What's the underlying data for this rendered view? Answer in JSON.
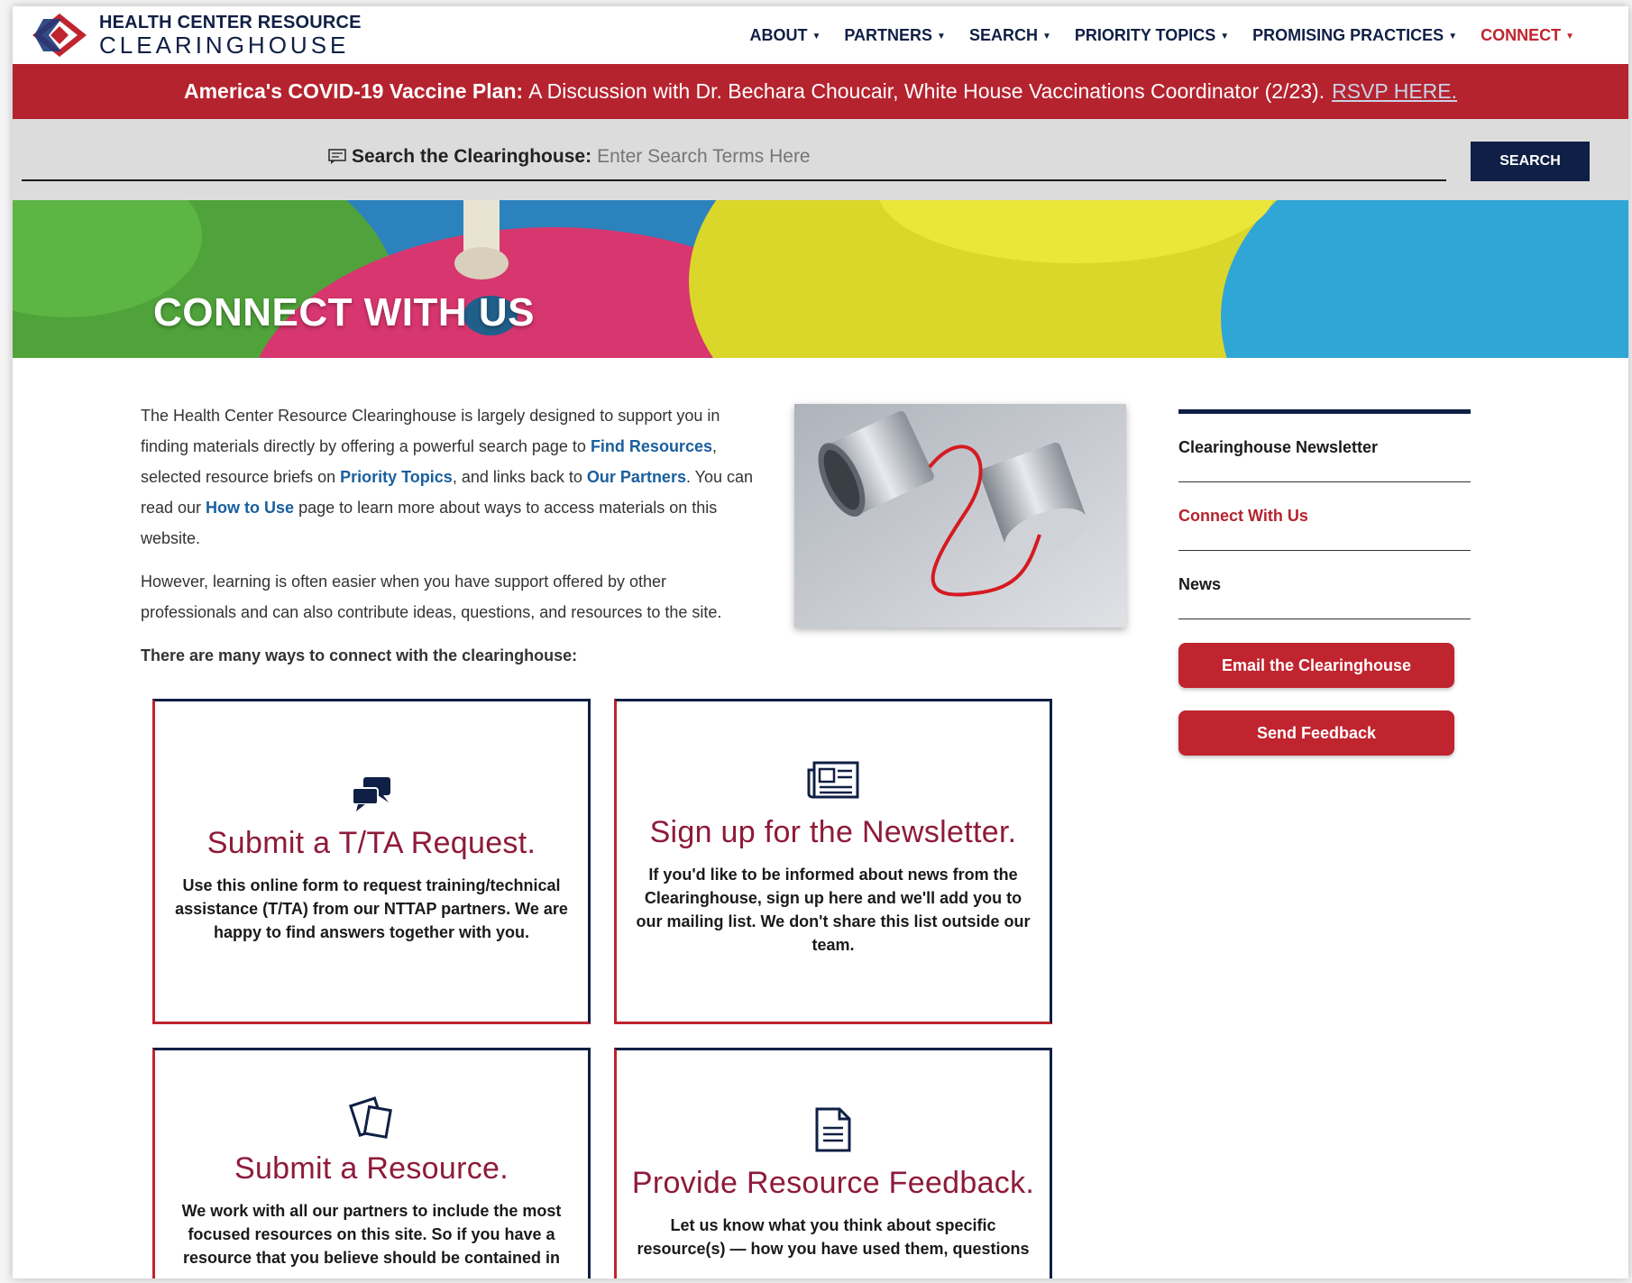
{
  "header": {
    "logo_line1": "HEALTH CENTER RESOURCE",
    "logo_line2": "CLEARINGHOUSE",
    "nav": [
      {
        "label": "ABOUT",
        "active": false
      },
      {
        "label": "PARTNERS",
        "active": false
      },
      {
        "label": "SEARCH",
        "active": false
      },
      {
        "label": "PRIORITY TOPICS",
        "active": false
      },
      {
        "label": "PROMISING PRACTICES",
        "active": false
      },
      {
        "label": "CONNECT",
        "active": true
      }
    ]
  },
  "alert": {
    "bold": "America's COVID-19 Vaccine Plan:",
    "text": "A Discussion with Dr. Bechara Choucair, White House Vaccinations Coordinator (2/23).",
    "link": "RSVP HERE."
  },
  "search": {
    "label": "Search the Clearinghouse:",
    "placeholder": "Enter Search Terms Here",
    "button": "SEARCH"
  },
  "hero": {
    "title": "CONNECT WITH US"
  },
  "intro": {
    "p1_a": "The Health Center Resource Clearinghouse is largely designed to support you in finding materials directly by offering a powerful search page to ",
    "link_find": "Find Resources",
    "p1_b": ", selected resource briefs on ",
    "link_priority": "Priority Topics",
    "p1_c": ", and links back to ",
    "link_partners": "Our Partners",
    "p1_d": ". You can read our ",
    "link_howto": "How to Use",
    "p1_e": " page to learn more about ways to access materials on this website.",
    "p2": "However, learning is often easier when you have support offered by other professionals and can also contribute ideas, questions, and resources to the site.",
    "p3": "There are many ways to connect with the clearinghouse:"
  },
  "sidebar": {
    "items": [
      {
        "label": "Clearinghouse Newsletter",
        "active": false
      },
      {
        "label": "Connect With Us",
        "active": true
      },
      {
        "label": "News",
        "active": false
      }
    ],
    "email_button": "Email the Clearinghouse",
    "feedback_button": "Send Feedback"
  },
  "cards": [
    {
      "title": "Submit a T/TA Request.",
      "icon": "chat-bubbles-icon",
      "text": "Use this online form to request training/technical assistance (T/TA) from our NTTAP partners. We are happy to find answers together with you."
    },
    {
      "title": "Sign up for the Newsletter.",
      "icon": "newspaper-icon",
      "text": "If you'd like to be informed about news from the Clearinghouse, sign up here and we'll add you to our mailing list. We don't share this list outside our team."
    },
    {
      "title": "Submit a Resource.",
      "icon": "documents-icon",
      "text": "We work with all our partners to include the most focused resources on this site. So if you have a resource that you believe should be contained in"
    },
    {
      "title": "Provide Resource Feedback.",
      "icon": "document-icon",
      "text": "Let us know what you think about specific resource(s) — how you have used them, questions"
    }
  ],
  "colors": {
    "navy": "#0f1f45",
    "red": "#c0242f",
    "maroon": "#8e1a3a",
    "link": "#1a5f9e"
  }
}
